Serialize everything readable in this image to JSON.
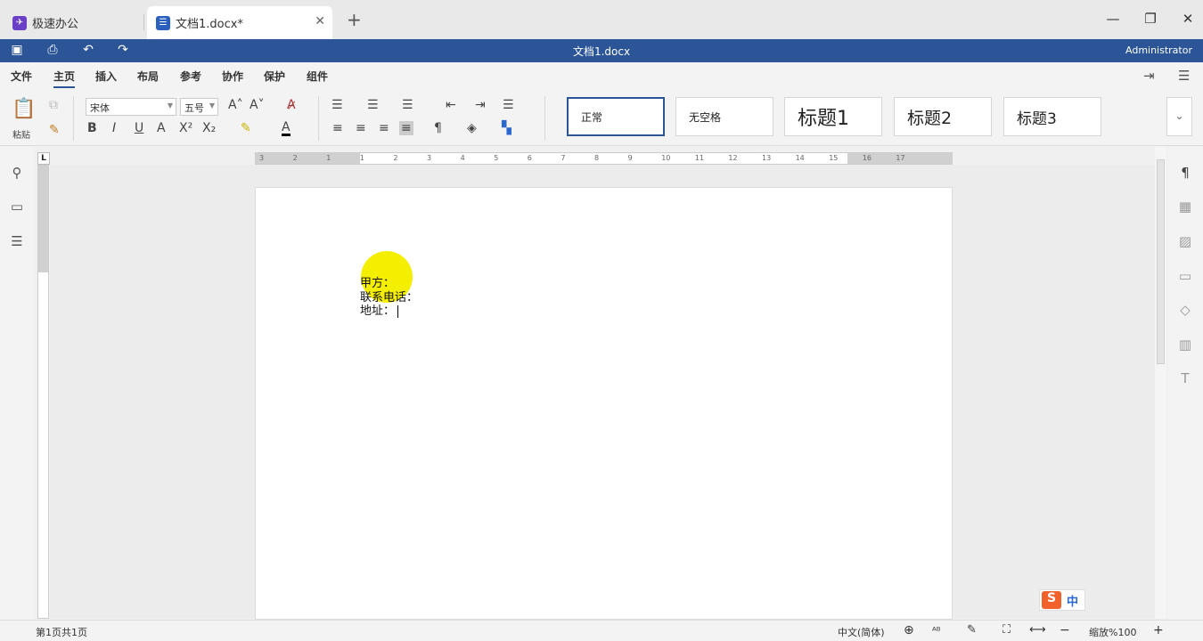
{
  "tabs": [
    {
      "label": "极速办公"
    },
    {
      "label": "文档1.docx*"
    }
  ],
  "titlebar": {
    "title": "文档1.docx",
    "user": "Administrator"
  },
  "menu": [
    "文件",
    "主页",
    "插入",
    "布局",
    "参考",
    "协作",
    "保护",
    "组件"
  ],
  "ribbon": {
    "paste_label": "粘贴",
    "font_name": "宋体",
    "font_size": "五号",
    "styles": [
      "正常",
      "无空格",
      "标题1",
      "标题2",
      "标题3"
    ]
  },
  "document": {
    "lines": [
      "甲方：",
      "联系电话：",
      "地址："
    ]
  },
  "ruler": {
    "h_ticks": [
      "3",
      "2",
      "1",
      "1",
      "2",
      "3",
      "4",
      "5",
      "6",
      "7",
      "8",
      "9",
      "10",
      "11",
      "12",
      "13",
      "14",
      "15",
      "16",
      "17"
    ]
  },
  "ime": {
    "label": "中"
  },
  "statusbar": {
    "page_info": "第1页共1页",
    "language": "中文(简体)",
    "zoom": "缩放%100"
  },
  "colors": {
    "accent": "#2b5597",
    "highlight": "#f4ef00"
  }
}
